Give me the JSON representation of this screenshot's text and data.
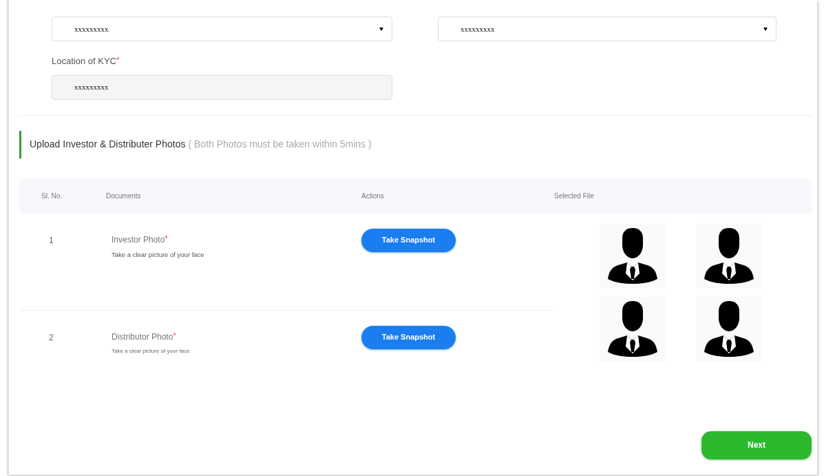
{
  "fields": [
    {
      "kind": "select",
      "value": "xxxxxxxxx"
    },
    {
      "kind": "select",
      "value": "xxxxxxxxx"
    }
  ],
  "location_of_kyc": {
    "label": "Location of KYC",
    "required_mark": "*",
    "value": "xxxxxxxxx"
  },
  "section": {
    "title": "Upload Investor & Distributer Photos",
    "note": "( Both Photos must be taken within 5mins )"
  },
  "table": {
    "columns": [
      "Sl. No.",
      "Documents",
      "Actions",
      "Selected File"
    ],
    "rows": [
      {
        "number": "1",
        "title": "Investor Photo",
        "required_mark": "*",
        "hint": "Take a clear picture of your face",
        "action": "Take Snapshot"
      },
      {
        "number": "2",
        "title": "Distributor Photo",
        "required_mark": "*",
        "hint": "Take a clear picture of your face",
        "action": "Take Snapshot"
      }
    ]
  },
  "next_button": "Next"
}
